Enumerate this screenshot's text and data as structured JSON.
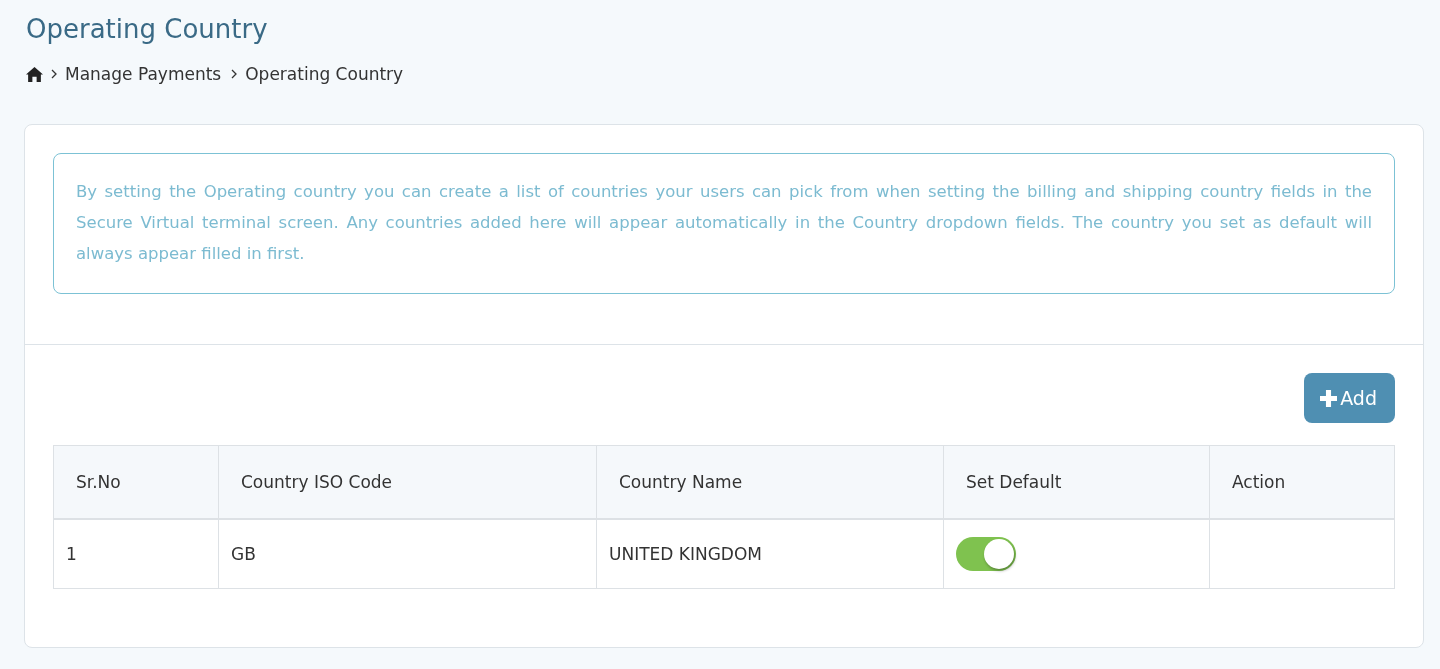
{
  "page": {
    "title": "Operating Country"
  },
  "breadcrumb": [
    "Manage Payments",
    "Operating Country"
  ],
  "info": "By setting the Operating country you can create a list of countries your users can pick from when setting the billing and shipping country fields in the Secure Virtual terminal screen. Any countries added here will appear automatically in the Country dropdown fields. The country you set as default will always appear filled in first.",
  "add_button": {
    "label": "Add"
  },
  "table": {
    "columns": [
      "Sr.No",
      "Country ISO Code",
      "Country Name",
      "Set Default",
      "Action"
    ],
    "rows": [
      {
        "sr_no": "1",
        "iso_code": "GB",
        "name": "UNITED KINGDOM",
        "default_on": true
      }
    ]
  }
}
